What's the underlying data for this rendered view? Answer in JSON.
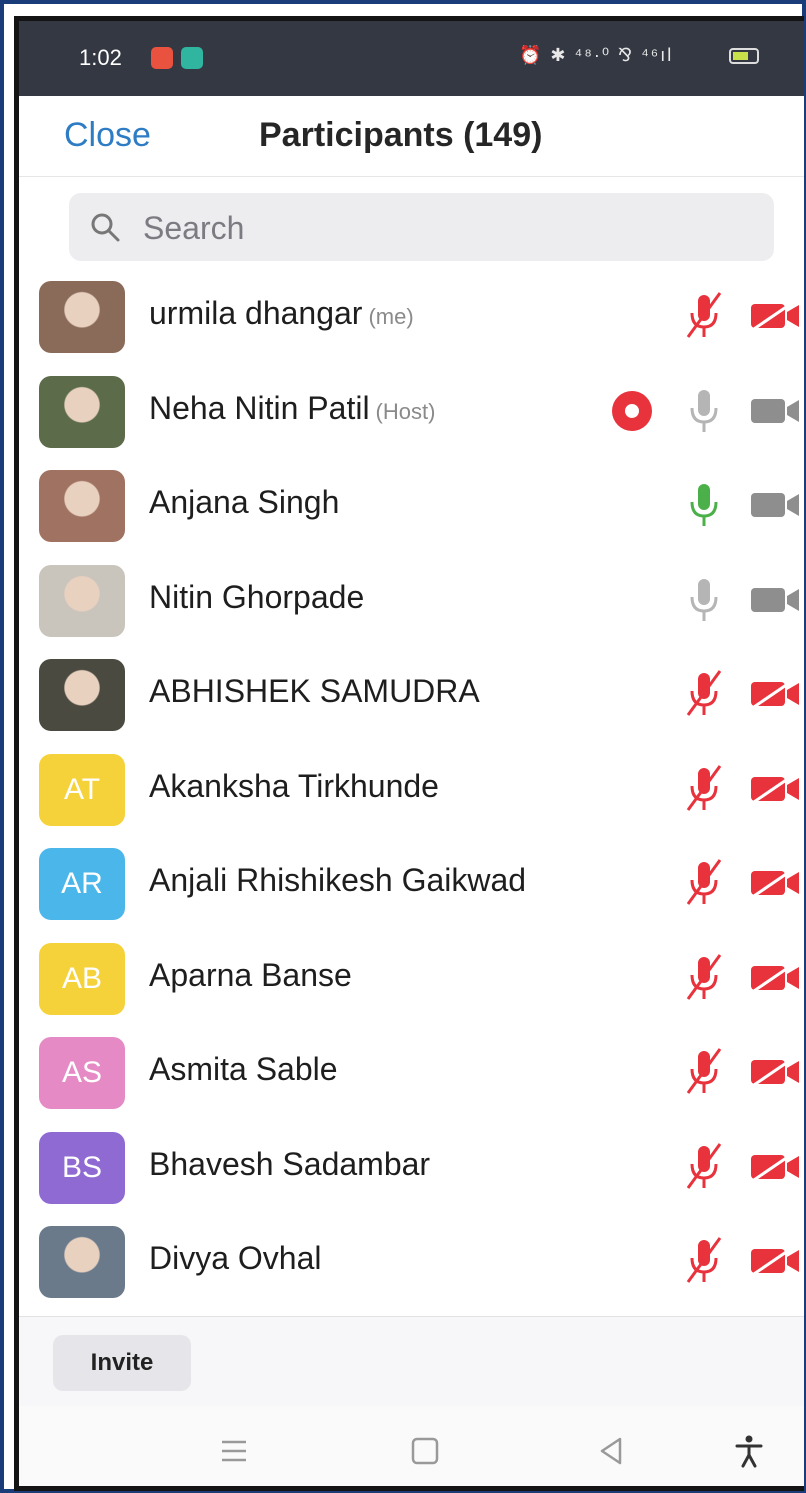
{
  "status_bar": {
    "time": "1:02",
    "right_icons": "⏰ ✱ ⁴⁸·⁰ ⅋ ⁴⁶ıl"
  },
  "header": {
    "close_label": "Close",
    "title": "Participants (149)"
  },
  "search": {
    "placeholder": "Search"
  },
  "participants": [
    {
      "name": "urmila dhangar",
      "tag": "(me)",
      "avatar": "photo",
      "avatar_color": "#8a6b5a",
      "mic": "muted",
      "video": "off"
    },
    {
      "name": "Neha Nitin Patil",
      "tag": "(Host)",
      "avatar": "photo",
      "avatar_color": "#5c6b4a",
      "mic": "idle",
      "video": "on",
      "recording": true
    },
    {
      "name": "Anjana Singh",
      "tag": "",
      "avatar": "photo",
      "avatar_color": "#a07262",
      "mic": "active",
      "video": "on"
    },
    {
      "name": "Nitin Ghorpade",
      "tag": "",
      "avatar": "photo",
      "avatar_color": "#c9c4bc",
      "mic": "idle",
      "video": "on"
    },
    {
      "name": "ABHISHEK SAMUDRA",
      "tag": "",
      "avatar": "photo",
      "avatar_color": "#4a4a40",
      "mic": "muted",
      "video": "off"
    },
    {
      "name": "Akanksha Tirkhunde",
      "tag": "",
      "initials": "AT",
      "avatar_color": "#f6d23a",
      "mic": "muted",
      "video": "off"
    },
    {
      "name": "Anjali Rhishikesh Gaikwad",
      "tag": "",
      "initials": "AR",
      "avatar_color": "#4bb6ea",
      "mic": "muted",
      "video": "off"
    },
    {
      "name": "Aparna Banse",
      "tag": "",
      "initials": "AB",
      "avatar_color": "#f6d23a",
      "mic": "muted",
      "video": "off"
    },
    {
      "name": "Asmita Sable",
      "tag": "",
      "initials": "AS",
      "avatar_color": "#e58ac4",
      "mic": "muted",
      "video": "off"
    },
    {
      "name": "Bhavesh Sadambar",
      "tag": "",
      "initials": "BS",
      "avatar_color": "#8e6ad2",
      "mic": "muted",
      "video": "off"
    },
    {
      "name": "Divya Ovhal",
      "tag": "",
      "avatar": "photo",
      "avatar_color": "#6a7a8a",
      "mic": "muted",
      "video": "off"
    }
  ],
  "footer": {
    "invite_label": "Invite"
  },
  "colors": {
    "accent": "#2d7cc4",
    "muted_red": "#e8323c",
    "active_green": "#4cb04a",
    "idle_gray": "#b5b5b5"
  },
  "nav": [
    "menu-icon",
    "home-icon",
    "back-icon",
    "accessibility-icon"
  ]
}
